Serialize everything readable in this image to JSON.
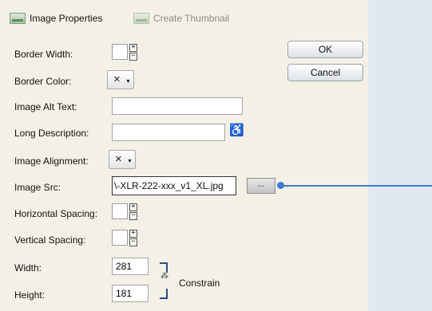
{
  "tabs": [
    {
      "label": "Image Properties",
      "icon": "image-icon",
      "active": true
    },
    {
      "label": "Create Thumbnail",
      "icon": "thumbnail-icon",
      "active": false
    }
  ],
  "fields": {
    "border_width": "Border Width:",
    "border_color": "Border Color:",
    "alt_text": "Image Alt Text:",
    "long_desc": "Long Description:",
    "alignment": "Image Alignment:",
    "src": "Image Src:",
    "h_spacing": "Horizontal Spacing:",
    "v_spacing": "Vertical Spacing:",
    "width": "Width:",
    "height": "Height:"
  },
  "values": {
    "src": "\\-XLR-222-xxx_v1_XL.jpg",
    "width": "281",
    "height": "181",
    "alt_text": "",
    "long_desc": ""
  },
  "buttons": {
    "ok": "OK",
    "cancel": "Cancel",
    "browse": "..."
  },
  "constrain_label": "Constrain",
  "icons": {
    "none_color": "×",
    "caret": "▼",
    "plus": "+",
    "minus": "−",
    "link": "⁂"
  },
  "colors": {
    "accent": "#3f7ad3",
    "panel": "#f3f1e6",
    "side": "#e2e8ef"
  }
}
